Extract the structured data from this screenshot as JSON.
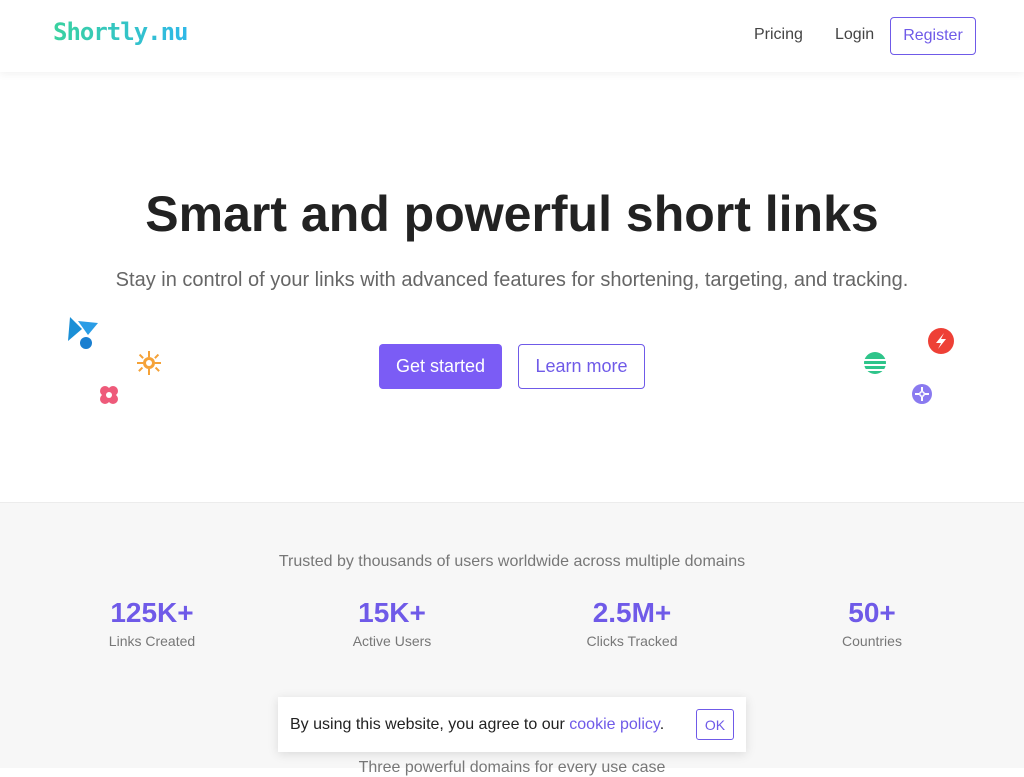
{
  "nav": {
    "logo": "Shortly.nu",
    "links": [
      "Pricing",
      "Login"
    ],
    "register": "Register"
  },
  "hero": {
    "title": "Smart and powerful short links",
    "subtitle": "Stay in control of your links with advanced features for shortening, targeting, and tracking.",
    "cta_primary": "Get started",
    "cta_secondary": "Learn more",
    "decorations": [
      "blue-shapes-icon",
      "orange-sun-icon",
      "pink-flower-icon",
      "green-stripes-icon",
      "red-zap-icon",
      "purple-gear-icon"
    ]
  },
  "stats": {
    "caption": "Trusted by thousands of users worldwide across multiple domains",
    "items": [
      {
        "value": "125K+",
        "label": "Links Created"
      },
      {
        "value": "15K+",
        "label": "Active Users"
      },
      {
        "value": "2.5M+",
        "label": "Clicks Tracked"
      },
      {
        "value": "50+",
        "label": "Countries"
      }
    ],
    "domains_caption": "Three powerful domains for every use case"
  },
  "cookie": {
    "text_before": "By using this website, you agree to our ",
    "link": "cookie policy",
    "text_after": ".",
    "ok": "OK"
  },
  "colors": {
    "accent": "#7b5cf5",
    "logo_gradient_start": "#3ad29f",
    "logo_gradient_end": "#2fb8e8"
  }
}
